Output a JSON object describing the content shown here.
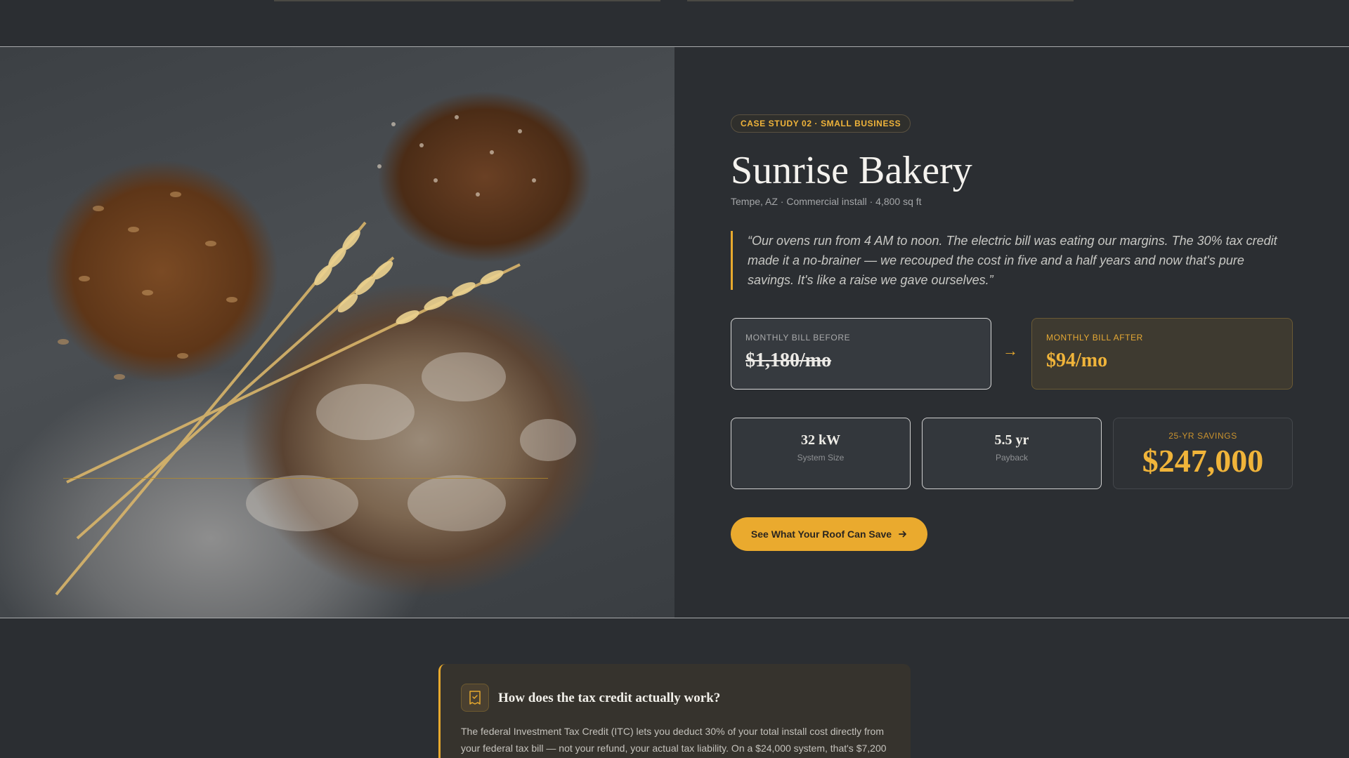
{
  "case": {
    "badge": "CASE STUDY 02 · SMALL BUSINESS",
    "title": "Sunrise Bakery",
    "subtitle": "Tempe, AZ · Commercial install · 4,800 sq ft",
    "quote": "“Our ovens run from 4 AM to noon. The electric bill was eating our margins. The 30% tax credit made it a no-brainer — we recouped the cost in five and a half years and now that's pure savings. It's like a raise we gave ourselves.”"
  },
  "bills": {
    "before_label": "MONTHLY BILL BEFORE",
    "before_value": "$1,180/mo",
    "after_label": "MONTHLY BILL AFTER",
    "after_value": "$94/mo",
    "arrow": "→"
  },
  "stats": {
    "system_size_value": "32 kW",
    "system_size_label": "System Size",
    "payback_value": "5.5 yr",
    "payback_label": "Payback",
    "savings_label": "25-YR SAVINGS",
    "savings_value": "$247,000"
  },
  "cta": {
    "label": "See What Your Roof Can Save",
    "icon": "arrow-right-icon"
  },
  "faq": {
    "title": "How does the tax credit actually work?",
    "body": "The federal Investment Tax Credit (ITC) lets you deduct 30% of your total install cost directly from your federal tax bill — not your refund, your actual tax liability. On a $24,000 system, that's $7,200",
    "icon": "receipt-icon"
  },
  "colors": {
    "accent": "#eaaa2e",
    "background": "#2b2e32"
  },
  "image": {
    "subject": "bread-loaves-with-wheat-photo"
  }
}
